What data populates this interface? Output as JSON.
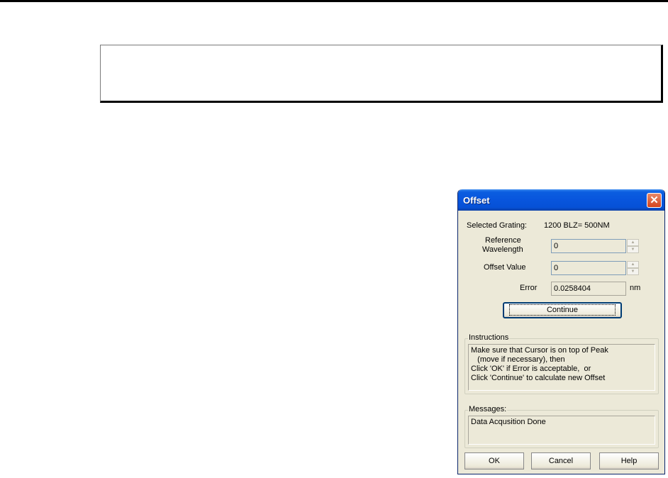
{
  "dialog": {
    "title": "Offset",
    "close_symbol": "✕",
    "selected_grating_label": "Selected Grating:",
    "selected_grating_value": "1200 BLZ= 500NM",
    "reference_wavelength_label_line1": "Reference",
    "reference_wavelength_label_line2": "Wavelength",
    "reference_wavelength_value": "0",
    "offset_value_label": "Offset Value",
    "offset_value_value": "0",
    "error_label": "Error",
    "error_value": "0.0258404",
    "error_unit": "nm",
    "continue_label": "Continue",
    "instructions": {
      "legend": "Instructions",
      "lines": [
        "Make sure that Cursor is on top of Peak",
        "   (move if necessary), then",
        "Click 'OK' if Error is acceptable,  or",
        "Click 'Continue' to calculate new Offset"
      ]
    },
    "messages": {
      "legend": "Messages:",
      "text": "Data Acqusition Done"
    },
    "buttons": {
      "ok": "OK",
      "cancel": "Cancel",
      "help": "Help"
    }
  }
}
